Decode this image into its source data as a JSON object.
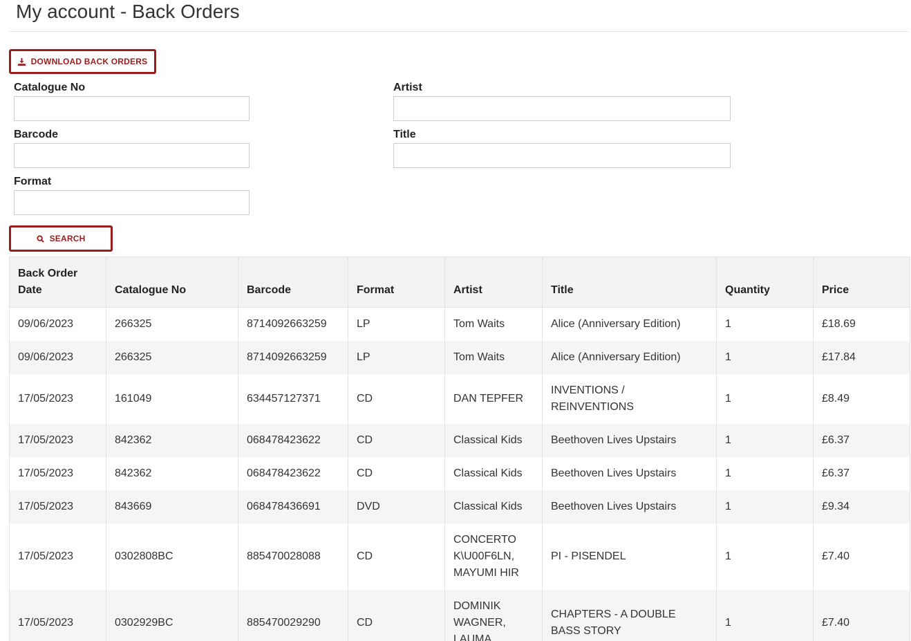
{
  "page": {
    "title": "My account - Back Orders"
  },
  "actions": {
    "download_label": "DOWNLOAD BACK ORDERS",
    "search_label": "SEARCH"
  },
  "filters": {
    "catalogue_no": {
      "label": "Catalogue No",
      "value": "",
      "placeholder": ""
    },
    "barcode": {
      "label": "Barcode",
      "value": "",
      "placeholder": ""
    },
    "format": {
      "label": "Format",
      "value": "",
      "placeholder": ""
    },
    "artist": {
      "label": "Artist",
      "value": "",
      "placeholder": ""
    },
    "title": {
      "label": "Title",
      "value": "",
      "placeholder": ""
    }
  },
  "table": {
    "headers": {
      "date": "Back Order Date",
      "catalogue_no": "Catalogue No",
      "barcode": "Barcode",
      "format": "Format",
      "artist": "Artist",
      "title": "Title",
      "quantity": "Quantity",
      "price": "Price"
    },
    "rows": [
      {
        "date": "09/06/2023",
        "catalogue_no": "266325",
        "barcode": "8714092663259",
        "format": "LP",
        "artist": "Tom Waits",
        "title": "Alice (Anniversary Edition)",
        "quantity": "1",
        "price": "£18.69"
      },
      {
        "date": "09/06/2023",
        "catalogue_no": "266325",
        "barcode": "8714092663259",
        "format": "LP",
        "artist": "Tom Waits",
        "title": "Alice (Anniversary Edition)",
        "quantity": "1",
        "price": "£17.84"
      },
      {
        "date": "17/05/2023",
        "catalogue_no": "161049",
        "barcode": "634457127371",
        "format": "CD",
        "artist": "DAN TEPFER",
        "title": "INVENTIONS / REINVENTIONS",
        "quantity": "1",
        "price": "£8.49"
      },
      {
        "date": "17/05/2023",
        "catalogue_no": "842362",
        "barcode": "068478423622",
        "format": "CD",
        "artist": "Classical Kids",
        "title": "Beethoven Lives Upstairs",
        "quantity": "1",
        "price": "£6.37"
      },
      {
        "date": "17/05/2023",
        "catalogue_no": "842362",
        "barcode": "068478423622",
        "format": "CD",
        "artist": "Classical Kids",
        "title": "Beethoven Lives Upstairs",
        "quantity": "1",
        "price": "£6.37"
      },
      {
        "date": "17/05/2023",
        "catalogue_no": "843669",
        "barcode": "068478436691",
        "format": "DVD",
        "artist": "Classical Kids",
        "title": "Beethoven Lives Upstairs",
        "quantity": "1",
        "price": "£9.34"
      },
      {
        "date": "17/05/2023",
        "catalogue_no": "0302808BC",
        "barcode": "885470028088",
        "format": "CD",
        "artist": "CONCERTO K\\U00F6LN, MAYUMI HIR",
        "title": "PI - PISENDEL",
        "quantity": "1",
        "price": "£7.40"
      },
      {
        "date": "17/05/2023",
        "catalogue_no": "0302929BC",
        "barcode": "885470029290",
        "format": "CD",
        "artist": "DOMINIK WAGNER, LAUMA",
        "title": "CHAPTERS - A DOUBLE BASS STORY",
        "quantity": "1",
        "price": "£7.40"
      }
    ]
  },
  "icons": {
    "download": "download-icon",
    "search": "search-icon"
  },
  "colors": {
    "accent": "#9b1c1c",
    "header_bg": "#f3f3f3",
    "row_alt_bg": "#f5f5f5"
  }
}
